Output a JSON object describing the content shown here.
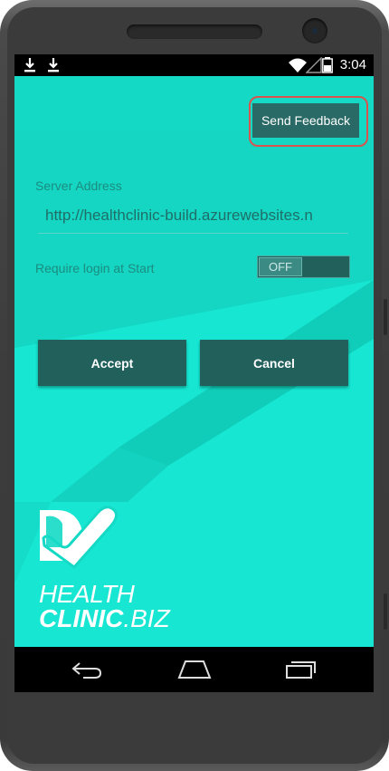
{
  "status_bar": {
    "time": "3:04",
    "icons": [
      "download-icon",
      "download-icon",
      "wifi-icon",
      "battery-icon"
    ]
  },
  "toolbar": {
    "feedback_label": "Send Feedback"
  },
  "form": {
    "server_address_label": "Server Address",
    "server_address_value": "http://healthclinic-build.azurewebsites.n",
    "require_login_label": "Require login at Start",
    "require_login_state": "OFF"
  },
  "actions": {
    "accept_label": "Accept",
    "cancel_label": "Cancel"
  },
  "branding": {
    "line1": "HEALTH",
    "line2_bold": "CLINIC",
    "line2_suffix": ".BIZ"
  },
  "nav_bar": {
    "icons": [
      "back-icon",
      "home-icon",
      "recent-apps-icon"
    ]
  },
  "colors": {
    "screen_background": "#14d9c5",
    "button_dark": "#22605c",
    "highlight_ring": "#d9534f"
  }
}
